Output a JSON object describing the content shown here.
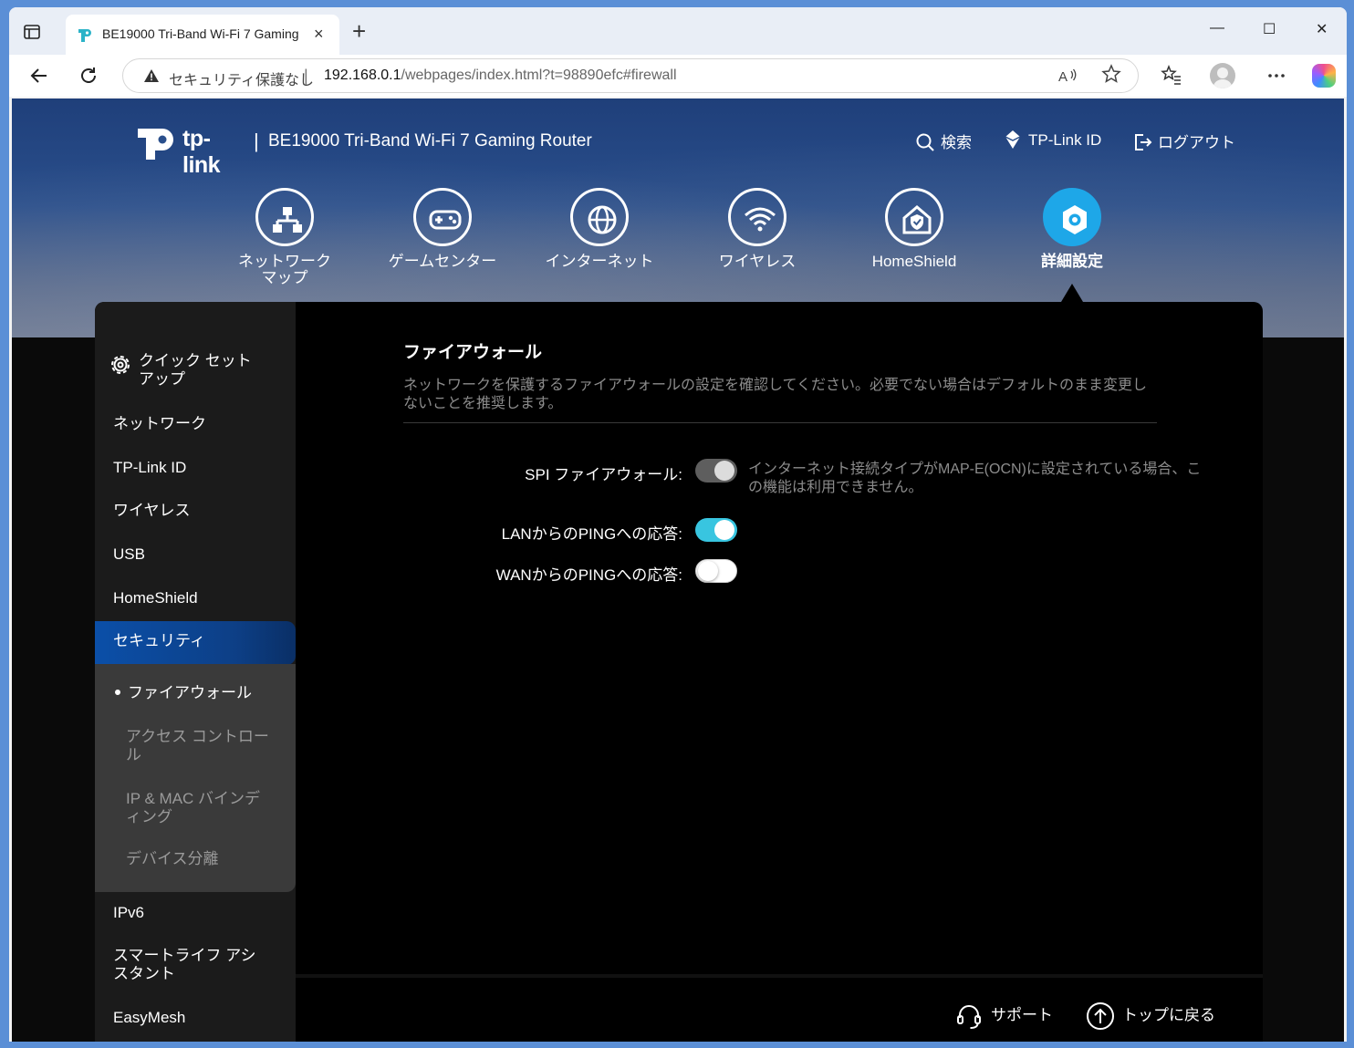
{
  "browser": {
    "tab_title": "BE19000 Tri-Band Wi-Fi 7 Gaming",
    "tab_close": "×",
    "new_tab": "+",
    "window_controls": {
      "minimize": "—",
      "maximize": "☐",
      "close": "✕"
    },
    "security_label": "セキュリティ保護なし",
    "separator": "|",
    "url_host": "192.168.0.1",
    "url_path": "/webpages/index.html?t=98890efc#firewall"
  },
  "header": {
    "logo_text": "tp-link",
    "divider": "|",
    "product_name": "BE19000 Tri-Band Wi-Fi 7 Gaming Router",
    "links": {
      "search": "検索",
      "tplink_id": "TP-Link ID",
      "logout": "ログアウト"
    }
  },
  "main_nav": [
    {
      "label": "ネットワーク\nマップ",
      "icon": "network-map-icon"
    },
    {
      "label": "ゲームセンター",
      "icon": "gamepad-icon"
    },
    {
      "label": "インターネット",
      "icon": "globe-icon"
    },
    {
      "label": "ワイヤレス",
      "icon": "wifi-icon"
    },
    {
      "label": "HomeShield",
      "icon": "homeshield-icon"
    },
    {
      "label": "詳細設定",
      "icon": "gear-icon",
      "active": true
    }
  ],
  "sidebar": {
    "quick_setup": "クイック セット\nアップ",
    "items": [
      "ネットワーク",
      "TP-Link ID",
      "ワイヤレス",
      "USB",
      "HomeShield",
      "セキュリティ",
      "IPv6",
      "スマートライフ アシ\nスタント",
      "EasyMesh"
    ],
    "active_item": "セキュリティ",
    "subitems": [
      "ファイアウォール",
      "アクセス コントロー\nル",
      "IP & MAC バインデ\nィング",
      "デバイス分離"
    ],
    "current_subitem": "ファイアウォール"
  },
  "content": {
    "title": "ファイアウォール",
    "description": "ネットワークを保護するファイアウォールの設定を確認してください。必要でない場合はデフォルトのまま変更しないことを推奨します。",
    "settings": [
      {
        "label": "SPI ファイアウォール:",
        "state": "disabled-on"
      },
      {
        "label": "LANからのPINGへの応答:",
        "state": "on"
      },
      {
        "label": "WANからのPINGへの応答:",
        "state": "off"
      }
    ],
    "spi_note": "インターネット接続タイプがMAP-E(OCN)に設定されている場合、この機能は利用できません。"
  },
  "footer": {
    "support": "サポート",
    "back_to_top": "トップに戻る"
  },
  "colors": {
    "accent": "#1ea7e8",
    "toggle_on": "#38c5e0",
    "active_sidebar": "#0b4fa8"
  }
}
